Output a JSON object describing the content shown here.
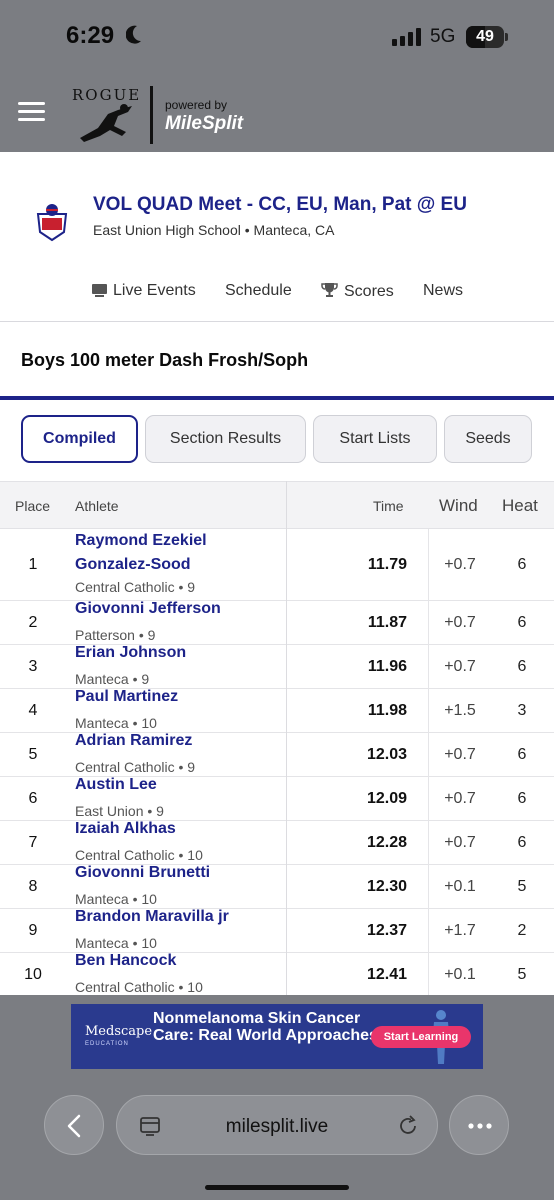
{
  "status_bar": {
    "time": "6:29",
    "network": "5G",
    "battery": "49"
  },
  "site_header": {
    "brand": "ROGUE",
    "powered_by": "powered by",
    "milesplit": "MileSplit"
  },
  "meet": {
    "title": "VOL QUAD Meet - CC, EU, Man, Pat @ EU",
    "subtitle": "East Union High School • Manteca, CA",
    "nav": [
      "Live Events",
      "Schedule",
      "Scores",
      "News"
    ]
  },
  "event": {
    "title": "Boys 100 meter Dash Frosh/Soph"
  },
  "tabs": [
    "Compiled",
    "Section Results",
    "Start Lists",
    "Seeds"
  ],
  "table": {
    "headers": {
      "place": "Place",
      "athlete": "Athlete",
      "time": "Time",
      "wind": "Wind",
      "heat": "Heat"
    },
    "rows": [
      {
        "place": "1",
        "name_line1": "Raymond Ezekiel",
        "name_line2": "Gonzalez-Sood",
        "team": "Central Catholic • 9",
        "time": "11.79",
        "wind": "+0.7",
        "heat": "6"
      },
      {
        "place": "2",
        "name_line1": "Giovonni Jefferson",
        "team": "Patterson • 9",
        "time": "11.87",
        "wind": "+0.7",
        "heat": "6"
      },
      {
        "place": "3",
        "name_line1": "Erian Johnson",
        "team": "Manteca • 9",
        "time": "11.96",
        "wind": "+0.7",
        "heat": "6"
      },
      {
        "place": "4",
        "name_line1": "Paul Martinez",
        "team": "Manteca • 10",
        "time": "11.98",
        "wind": "+1.5",
        "heat": "3"
      },
      {
        "place": "5",
        "name_line1": "Adrian Ramirez",
        "team": "Central Catholic • 9",
        "time": "12.03",
        "wind": "+0.7",
        "heat": "6"
      },
      {
        "place": "6",
        "name_line1": "Austin Lee",
        "team": "East Union • 9",
        "time": "12.09",
        "wind": "+0.7",
        "heat": "6"
      },
      {
        "place": "7",
        "name_line1": "Izaiah Alkhas",
        "team": "Central Catholic • 10",
        "time": "12.28",
        "wind": "+0.7",
        "heat": "6"
      },
      {
        "place": "8",
        "name_line1": "Giovonni Brunetti",
        "team": "Manteca • 10",
        "time": "12.30",
        "wind": "+0.1",
        "heat": "5"
      },
      {
        "place": "9",
        "name_line1": "Brandon Maravilla jr",
        "team": "Manteca • 10",
        "time": "12.37",
        "wind": "+1.7",
        "heat": "2"
      },
      {
        "place": "10",
        "name_line1": "Ben Hancock",
        "team": "Central Catholic • 10",
        "time": "12.41",
        "wind": "+0.1",
        "heat": "5"
      }
    ]
  },
  "ad": {
    "brand": "Medscape",
    "brand_sub": "EDUCATION",
    "text": "Nonmelanoma Skin Cancer Care: Real World Approaches",
    "cta": "Start Learning"
  },
  "browser": {
    "url": "milesplit.live"
  },
  "colors": {
    "brand_navy": "#1d2389",
    "chrome_gray": "#7b7d82",
    "ad_blue": "#2a3a8e",
    "ad_cta": "#e9356b"
  },
  "icons": [
    "moon-icon",
    "signal-icon",
    "hamburger-icon",
    "live-events-icon",
    "trophy-icon",
    "back-icon",
    "tabs-icon",
    "reload-icon",
    "more-icon"
  ]
}
